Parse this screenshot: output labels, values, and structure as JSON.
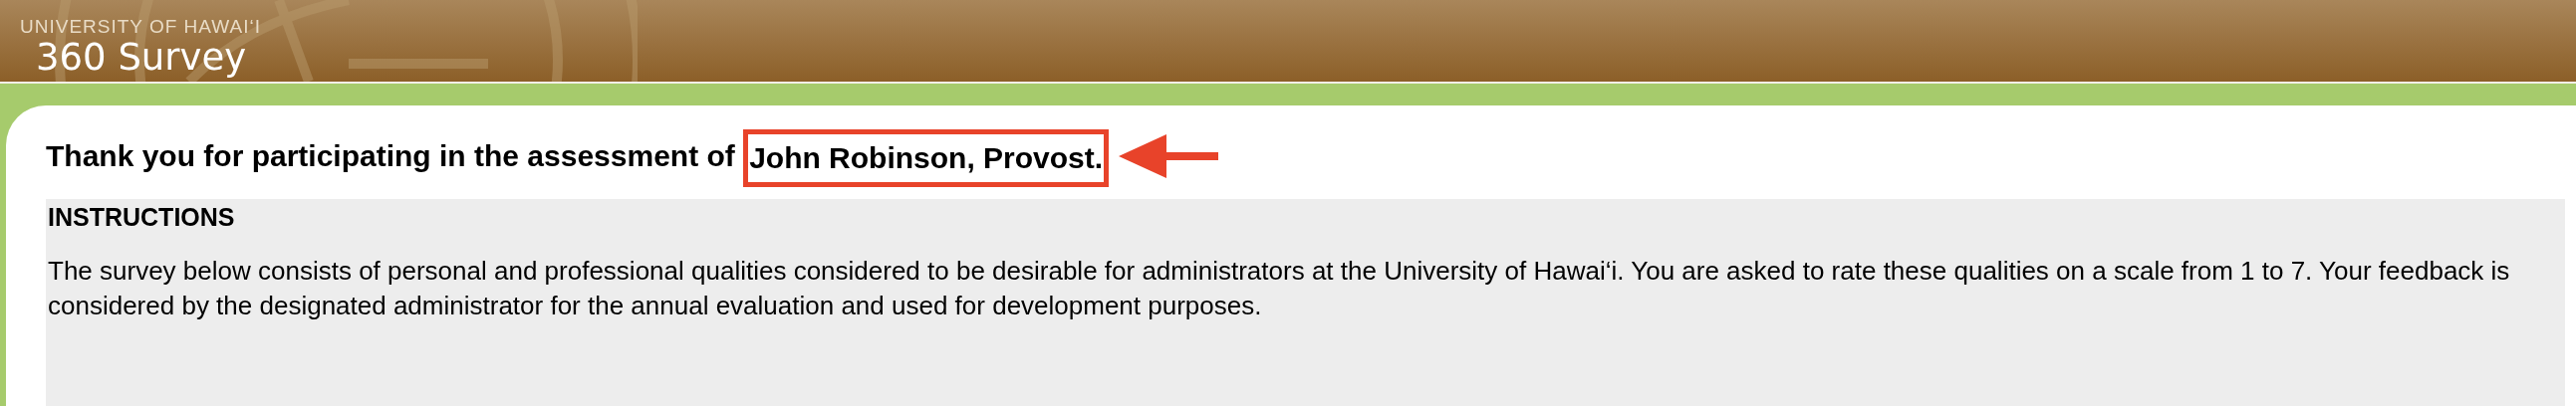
{
  "header": {
    "university": "UNIVERSITY OF HAWAI‘I",
    "title": "360 Survey"
  },
  "heading": {
    "lead": "Thank you for participating in the assessment of ",
    "subject": "John Robinson, Provost.",
    "highlighted": true
  },
  "instructions": {
    "title": "INSTRUCTIONS",
    "text": "The survey below consists of personal and professional qualities considered to be desirable for administrators at the University of Hawai‘i. You are asked to rate these qualities on a scale from 1 to 7. Your feedback is considered by the designated administrator for the annual evaluation and used for development purposes."
  }
}
